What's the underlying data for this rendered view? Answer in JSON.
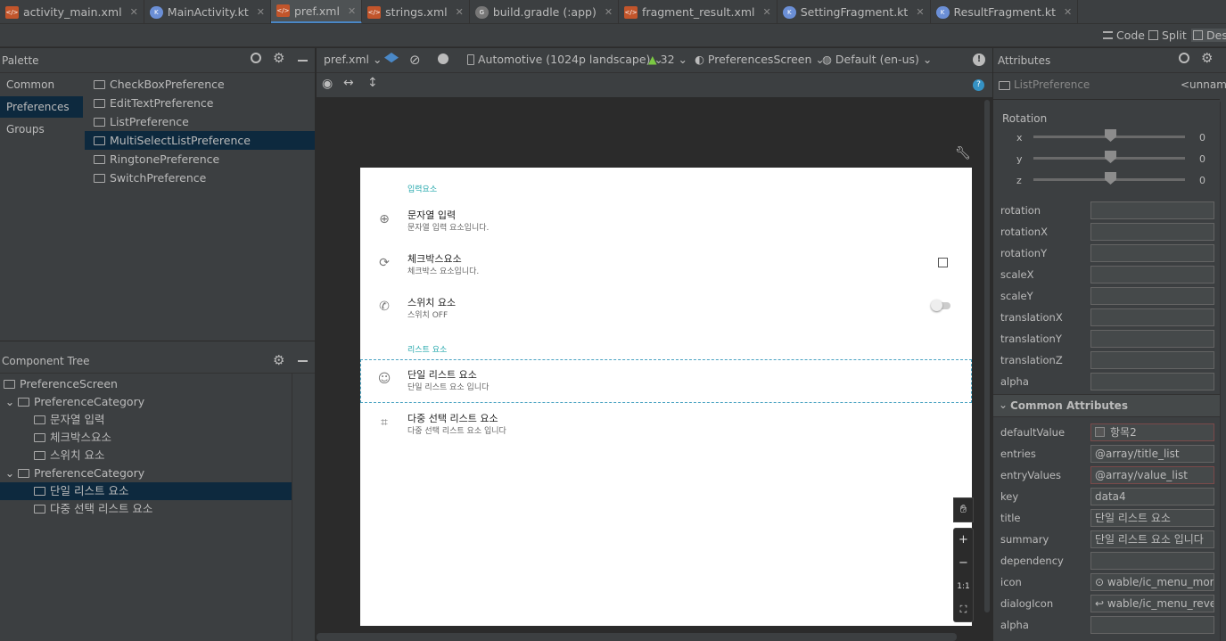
{
  "tabs": [
    {
      "label": "activity_main.xml",
      "type": "xml"
    },
    {
      "label": "MainActivity.kt",
      "type": "kt"
    },
    {
      "label": "pref.xml",
      "type": "xml",
      "active": true
    },
    {
      "label": "strings.xml",
      "type": "xml"
    },
    {
      "label": "build.gradle (:app)",
      "type": "gradle"
    },
    {
      "label": "fragment_result.xml",
      "type": "xml"
    },
    {
      "label": "SettingFragment.kt",
      "type": "kt"
    },
    {
      "label": "ResultFragment.kt",
      "type": "kt"
    }
  ],
  "view_modes": {
    "code": "Code",
    "split": "Split",
    "design": "Desi"
  },
  "palette": {
    "title": "Palette",
    "categories": [
      "Common",
      "Preferences",
      "Groups"
    ],
    "selected_category": "Preferences",
    "items": [
      "CheckBoxPreference",
      "EditTextPreference",
      "ListPreference",
      "MultiSelectListPreference",
      "RingtonePreference",
      "SwitchPreference"
    ],
    "selected_item": "MultiSelectListPreference"
  },
  "component_tree": {
    "title": "Component Tree",
    "nodes": [
      {
        "label": "PreferenceScreen",
        "depth": 0
      },
      {
        "label": "PreferenceCategory",
        "depth": 1,
        "expander": true
      },
      {
        "label": "문자열 입력",
        "depth": 2
      },
      {
        "label": "체크박스요소",
        "depth": 2
      },
      {
        "label": "스위치 요소",
        "depth": 2
      },
      {
        "label": "PreferenceCategory",
        "depth": 1,
        "expander": true
      },
      {
        "label": "단일 리스트 요소",
        "depth": 2,
        "selected": true
      },
      {
        "label": "다중 선택 리스트 요소",
        "depth": 2
      }
    ]
  },
  "design_toolbar": {
    "file": "pref.xml",
    "device": "Automotive (1024p landscape)",
    "api": "32",
    "theme": "PreferencesScreen",
    "locale": "Default (en-us)"
  },
  "preview": {
    "category1": "입력요소",
    "category2": "리스트 요소",
    "rows": [
      {
        "title": "문자열 입력",
        "summary": "문자열 입력 요소입니다.",
        "icon": "gear-icon"
      },
      {
        "title": "체크박스요소",
        "summary": "체크박스 요소입니다.",
        "icon": "rotate-icon"
      },
      {
        "title": "스위치 요소",
        "summary": "스위치 OFF",
        "icon": "phone-icon"
      },
      {
        "title": "단일 리스트 요소",
        "summary": "단일 리스트 요소 입니다",
        "icon": "smile-icon"
      },
      {
        "title": "다중 선택 리스트 요소",
        "summary": "다중 선택 리스트 요소 입니다",
        "icon": "crop-icon"
      }
    ],
    "zoom_reset": "1:1"
  },
  "attributes": {
    "title": "Attributes",
    "widget": "ListPreference",
    "widget_id": "<unnamed>",
    "rotation_label": "Rotation",
    "rotation": [
      {
        "axis": "x",
        "value": "0"
      },
      {
        "axis": "y",
        "value": "0"
      },
      {
        "axis": "z",
        "value": "0"
      }
    ],
    "transform_rows": [
      "rotation",
      "rotationX",
      "rotationY",
      "scaleX",
      "scaleY",
      "translationX",
      "translationY",
      "translationZ",
      "alpha"
    ],
    "common_title": "Common Attributes",
    "common_rows": [
      {
        "label": "defaultValue",
        "value": "항목2",
        "red": true,
        "swatch": true
      },
      {
        "label": "entries",
        "value": "@array/title_list"
      },
      {
        "label": "entryValues",
        "value": "@array/value_list",
        "red": true
      },
      {
        "label": "key",
        "value": "data4"
      },
      {
        "label": "title",
        "value": "단일 리스트 요소"
      },
      {
        "label": "summary",
        "value": "단일 리스트 요소 입니다"
      },
      {
        "label": "dependency",
        "value": ""
      },
      {
        "label": "icon",
        "value": "wable/ic_menu_more"
      },
      {
        "label": "dialogIcon",
        "value": "wable/ic_menu_revert"
      },
      {
        "label": "alpha",
        "value": ""
      }
    ]
  },
  "colors": {
    "selection": "#0d293e",
    "accent": "#4a88c7",
    "teal": "#26a8ad"
  }
}
